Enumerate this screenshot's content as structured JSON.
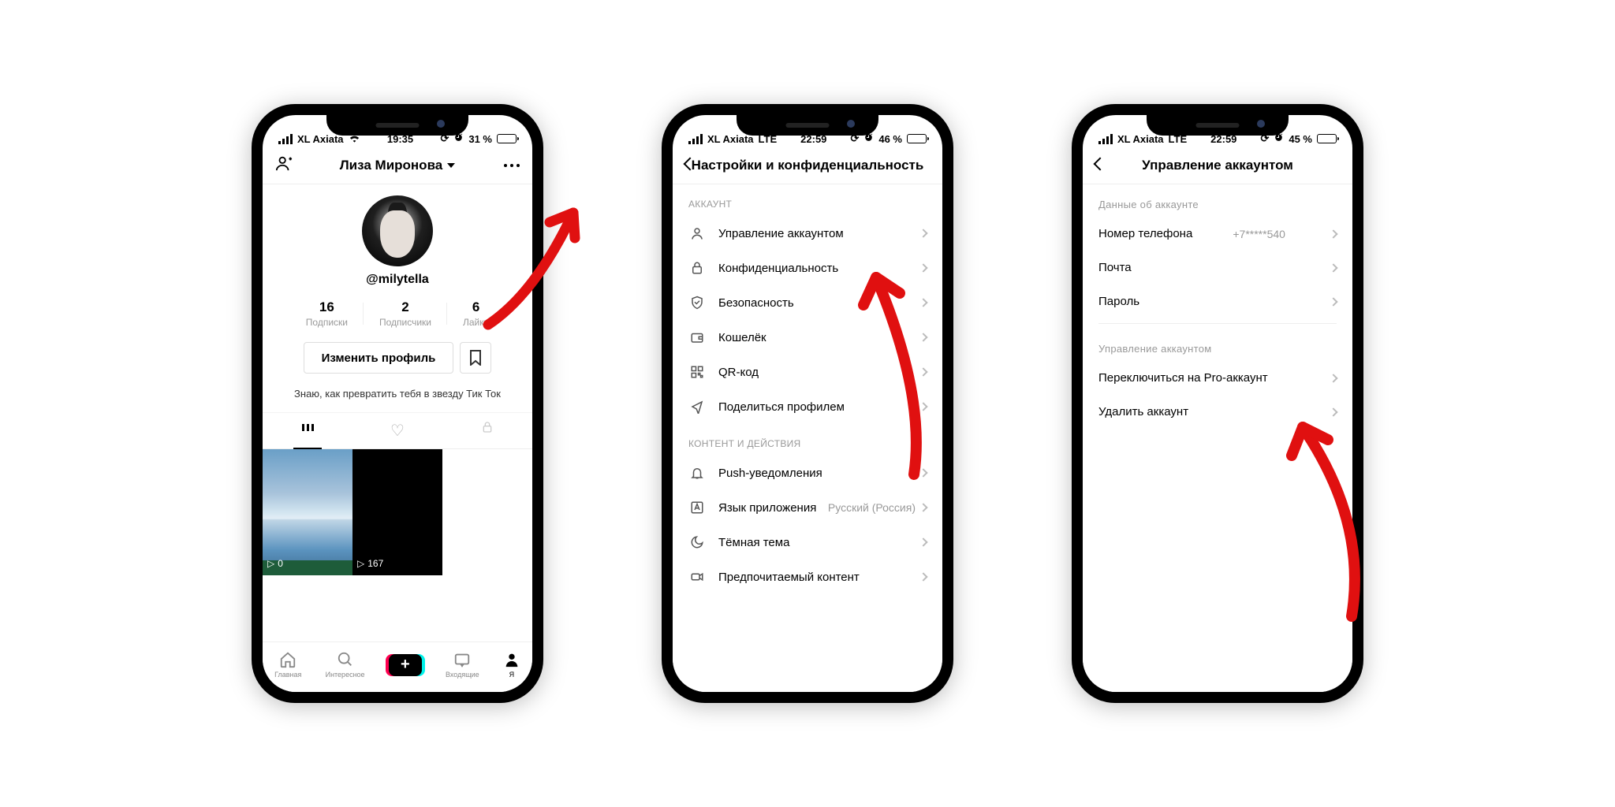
{
  "phone1": {
    "status": {
      "carrier": "XL Axiata",
      "network_wifi": true,
      "time": "19:35",
      "alarm": true,
      "battery_pct": "31 %"
    },
    "header": {
      "title": "Лиза Миронова"
    },
    "profile": {
      "username": "@milytella",
      "stats": [
        {
          "num": "16",
          "label": "Подписки"
        },
        {
          "num": "2",
          "label": "Подписчики"
        },
        {
          "num": "6",
          "label": "Лайки"
        }
      ],
      "edit_label": "Изменить профиль",
      "bio": "Знаю, как превратить тебя в звезду Тик Ток",
      "thumbs": [
        {
          "plays": "0"
        },
        {
          "plays": "167"
        }
      ]
    },
    "bottomnav": {
      "home": "Главная",
      "discover": "Интересное",
      "inbox": "Входящие",
      "me": "Я"
    }
  },
  "phone2": {
    "status": {
      "carrier": "XL Axiata",
      "network": "LTE",
      "time": "22:59",
      "battery_pct": "46 %"
    },
    "header": {
      "title": "Настройки и конфиденциальность"
    },
    "section_account": "АККАУНТ",
    "items_account": [
      {
        "label": "Управление аккаунтом"
      },
      {
        "label": "Конфиденциальность"
      },
      {
        "label": "Безопасность"
      },
      {
        "label": "Кошелёк"
      },
      {
        "label": "QR-код"
      },
      {
        "label": "Поделиться профилем"
      }
    ],
    "section_content": "КОНТЕНТ И ДЕЙСТВИЯ",
    "items_content": [
      {
        "label": "Push-уведомления"
      },
      {
        "label": "Язык приложения",
        "value": "Русский (Россия)"
      },
      {
        "label": "Тёмная тема"
      },
      {
        "label": "Предпочитаемый контент"
      }
    ]
  },
  "phone3": {
    "status": {
      "carrier": "XL Axiata",
      "network": "LTE",
      "time": "22:59",
      "battery_pct": "45 %"
    },
    "header": {
      "title": "Управление аккаунтом"
    },
    "section_data": "Данные об аккаунте",
    "items_data": [
      {
        "label": "Номер телефона",
        "value": "+7*****540"
      },
      {
        "label": "Почта"
      },
      {
        "label": "Пароль"
      }
    ],
    "section_manage": "Управление аккаунтом",
    "items_manage": [
      {
        "label": "Переключиться на Pro-аккаунт"
      },
      {
        "label": "Удалить аккаунт"
      }
    ]
  }
}
